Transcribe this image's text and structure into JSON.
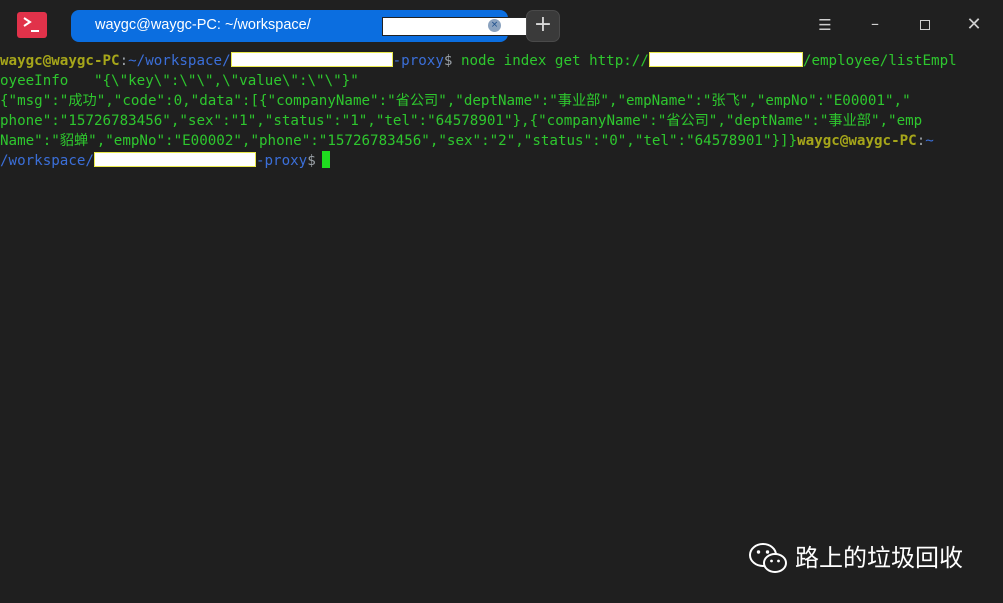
{
  "window": {
    "tab_title": "waygc@waygc-PC: ~/workspace/",
    "tab_close_glyph": "×",
    "new_tab_glyph": "+",
    "menu_glyph": "☰",
    "minimize_glyph": "–",
    "close_glyph": "✕"
  },
  "terminal": {
    "prompt_user": "waygc@waygc-PC",
    "prompt_colon": ":",
    "prompt_path": "~/workspace/",
    "prompt_path_start": "/workspace/",
    "prompt_suffix": "-proxy",
    "prompt_dollar": "$",
    "command": " node index get http://",
    "command_tail": "/employee/listEmpl",
    "line2": "oyeeInfo   \"{\\\"key\\\":\\\"\\\",\\\"value\\\":\\\"\\\"}\"",
    "line3": "{\"msg\":\"成功\",\"code\":0,\"data\":[{\"companyName\":\"省公司\",\"deptName\":\"事业部\",\"empName\":\"张飞\",\"empNo\":\"E00001\",\"",
    "line4": "phone\":\"15726783456\",\"sex\":\"1\",\"status\":\"1\",\"tel\":\"64578901\"},{\"companyName\":\"省公司\",\"deptName\":\"事业部\",\"emp",
    "line5": "Name\":\"貂蝉\",\"empNo\":\"E00002\",\"phone\":\"15726783456\",\"sex\":\"2\",\"status\":\"0\",\"tel\":\"64578901\"}]}",
    "line5_user": "waygc@waygc-PC",
    "line5_colon": ":",
    "line5_path": "~"
  },
  "watermark": {
    "text": "路上的垃圾回收"
  },
  "colors": {
    "background": "#1f1f1f",
    "tab_active": "#0b6ee0",
    "prompt_user": "#a6a61a",
    "prompt_path": "#3b6fd9",
    "output": "#2ec72e",
    "cursor": "#1fdc1f",
    "app_icon": "#e1324a"
  }
}
